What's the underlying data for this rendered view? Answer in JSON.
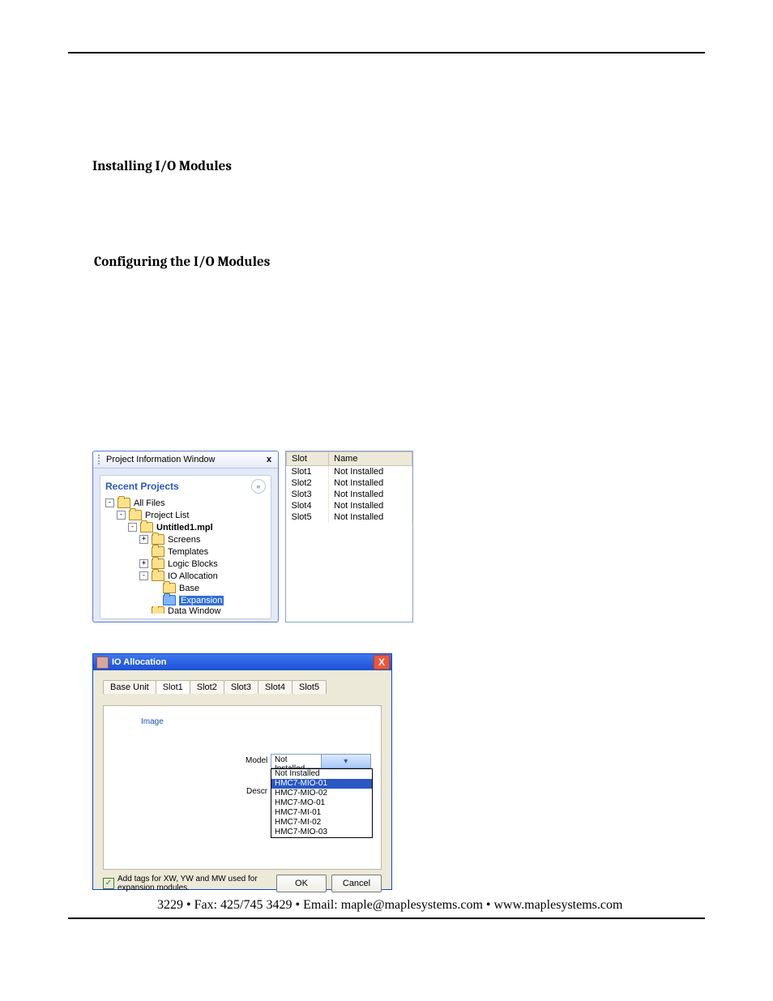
{
  "headings": {
    "h1": "Installing I/O Modules",
    "h2": "Configuring the I/O Modules"
  },
  "footer": "3229 • Fax: 425/745 3429 • Email: maple@maplesystems.com • www.maplesystems.com",
  "piw": {
    "title": "Project Information Window",
    "close": "x",
    "recent_label": "Recent Projects",
    "chevron": "«",
    "tree": [
      {
        "toggle": "-",
        "label": "All Files",
        "indent": 0,
        "bold": false
      },
      {
        "toggle": "-",
        "label": "Project List",
        "indent": 1,
        "bold": false
      },
      {
        "toggle": "-",
        "label": "Untitled1.mpl",
        "indent": 2,
        "bold": true
      },
      {
        "toggle": "+",
        "label": "Screens",
        "indent": 3,
        "bold": false
      },
      {
        "toggle": "",
        "label": "Templates",
        "indent": 3,
        "bold": false
      },
      {
        "toggle": "+",
        "label": "Logic Blocks",
        "indent": 3,
        "bold": false
      },
      {
        "toggle": "-",
        "label": "IO Allocation",
        "indent": 3,
        "bold": false
      },
      {
        "toggle": "",
        "label": "Base",
        "indent": 4,
        "bold": false
      },
      {
        "toggle": "",
        "label": "Expansion",
        "indent": 4,
        "bold": false,
        "selected": true
      },
      {
        "toggle": "",
        "label": "Data Window",
        "indent": 3,
        "bold": false,
        "cut": true
      }
    ]
  },
  "slotwin": {
    "col_slot": "Slot",
    "col_name": "Name",
    "rows": [
      {
        "slot": "Slot1",
        "name": "Not Installed"
      },
      {
        "slot": "Slot2",
        "name": "Not Installed"
      },
      {
        "slot": "Slot3",
        "name": "Not Installed"
      },
      {
        "slot": "Slot4",
        "name": "Not Installed"
      },
      {
        "slot": "Slot5",
        "name": "Not Installed"
      }
    ]
  },
  "ioa": {
    "title": "IO Allocation",
    "close": "X",
    "tabs": [
      "Base Unit",
      "Slot1",
      "Slot2",
      "Slot3",
      "Slot4",
      "Slot5"
    ],
    "active_tab": 1,
    "group_image": "Image",
    "label_model": "Model",
    "label_descr": "Descr",
    "model_value": "Not Installed",
    "model_options": [
      "Not Installed",
      "HMC7-MIO-01",
      "HMC7-MIO-02",
      "HMC7-MO-01",
      "HMC7-MI-01",
      "HMC7-MI-02",
      "HMC7-MIO-03"
    ],
    "model_selected_index": 1,
    "addtags_label": "Add tags for XW, YW and MW used for expansion  modules.",
    "addtags_checked": true,
    "ok": "OK",
    "cancel": "Cancel"
  }
}
